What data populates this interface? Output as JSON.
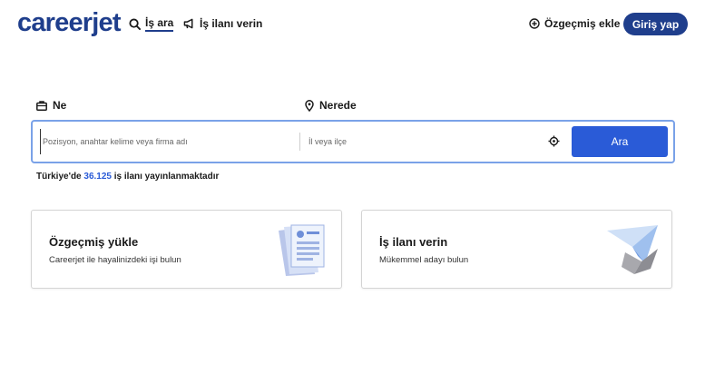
{
  "header": {
    "logo": "careerjet",
    "nav": {
      "search_label": "İş ara",
      "post_job_label": "İş ilanı verin"
    },
    "add_cv_label": "Özgeçmiş ekle",
    "login_label": "Giriş yap"
  },
  "search": {
    "what_label": "Ne",
    "where_label": "Nerede",
    "what_placeholder": "Pozisyon, anahtar kelime veya firma adı",
    "where_placeholder": "İl veya ilçe",
    "button_label": "Ara"
  },
  "stats": {
    "prefix": "Türkiye'de",
    "count": "36.125",
    "suffix": "iş ilanı yayınlanmaktadır"
  },
  "cards": {
    "cv": {
      "title": "Özgeçmiş yükle",
      "subtitle": "Careerjet ile hayalinizdeki işi bulun"
    },
    "job": {
      "title": "İş ilanı verin",
      "subtitle": "Mükemmel adayı bulun"
    }
  },
  "colors": {
    "brand": "#1f3e8c",
    "accent": "#2a5bd7",
    "search_border": "#7aa2e8"
  },
  "icons": {
    "nav_search": "search-icon",
    "nav_post": "megaphone-icon",
    "add_cv": "plus-circle-icon",
    "what": "briefcase-icon",
    "where": "map-pin-icon",
    "locate": "crosshair-icon"
  }
}
